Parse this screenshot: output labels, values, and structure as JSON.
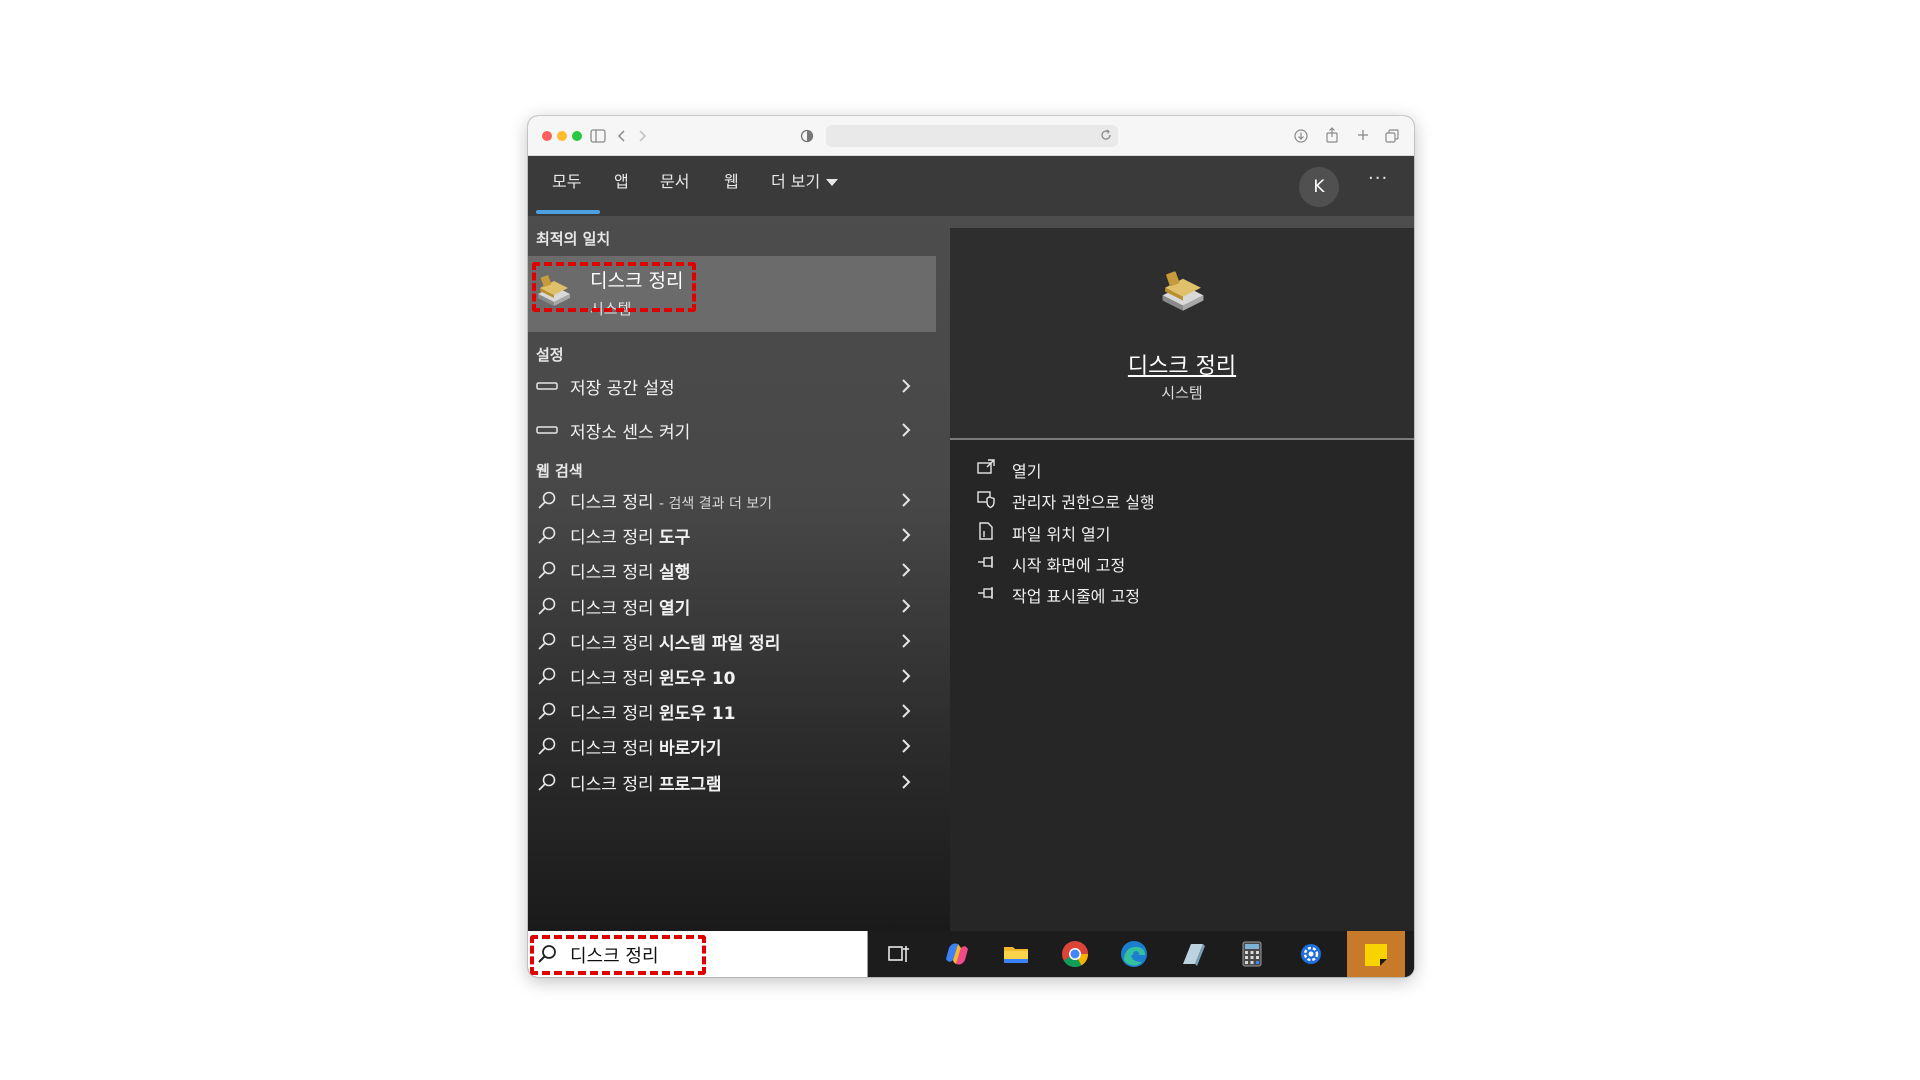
{
  "tabs": [
    {
      "label": "모두"
    },
    {
      "label": "앱"
    },
    {
      "label": "문서"
    },
    {
      "label": "웹"
    },
    {
      "label": "더 보기"
    }
  ],
  "account": {
    "initial": "K"
  },
  "more_label": "···",
  "best_match": {
    "heading": "최적의 일치",
    "name": "디스크 정리",
    "type": "시스템"
  },
  "settings": {
    "heading": "설정",
    "items": [
      {
        "label": "저장 공간 설정"
      },
      {
        "label": "저장소 센스 켜기"
      }
    ]
  },
  "web_search": {
    "heading": "웹 검색",
    "items": [
      {
        "base": "디스크 정리",
        "suffix": "- 검색 결과 더 보기"
      },
      {
        "base": "디스크 정리",
        "suffix": "도구"
      },
      {
        "base": "디스크 정리",
        "suffix": "실행"
      },
      {
        "base": "디스크 정리",
        "suffix": "열기"
      },
      {
        "base": "디스크 정리",
        "suffix": "시스템 파일 정리"
      },
      {
        "base": "디스크 정리",
        "suffix": "윈도우 10"
      },
      {
        "base": "디스크 정리",
        "suffix": "윈도우 11"
      },
      {
        "base": "디스크 정리",
        "suffix": "바로가기"
      },
      {
        "base": "디스크 정리",
        "suffix": "프로그램"
      }
    ]
  },
  "preview": {
    "name": "디스크 정리",
    "type": "시스템",
    "actions": [
      {
        "label": "열기",
        "icon": "open-icon"
      },
      {
        "label": "관리자 권한으로 실행",
        "icon": "admin-shield-icon"
      },
      {
        "label": "파일 위치 열기",
        "icon": "file-location-icon"
      },
      {
        "label": "시작 화면에 고정",
        "icon": "pin-icon"
      },
      {
        "label": "작업 표시줄에 고정",
        "icon": "pin-icon"
      }
    ]
  },
  "taskbar": {
    "search_value": "디스크 정리",
    "apps": [
      "task-view-icon",
      "copilot-icon",
      "file-explorer-icon",
      "chrome-icon",
      "edge-icon",
      "disk-cleanup-icon",
      "calculator-icon",
      "settings-app-icon",
      "sticky-notes-icon"
    ]
  },
  "colors": {
    "accent": "#4ca0e0",
    "highlight": "#e00000",
    "sticky_notes_bg": "#c67a2a"
  }
}
